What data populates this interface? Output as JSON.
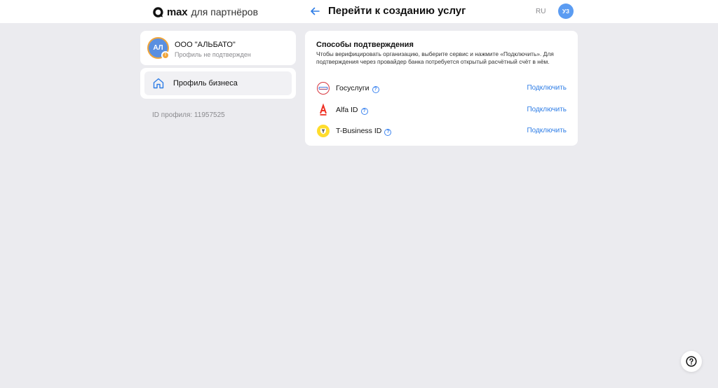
{
  "header": {
    "logo_brand": "max",
    "logo_suffix": "для партнёров",
    "title": "Перейти к созданию услуг",
    "lang": "RU",
    "user_initials": "УЗ"
  },
  "sidebar": {
    "org": {
      "initials": "АЛ",
      "badge": "!",
      "name": "ООО \"АЛЬБАТО\"",
      "status": "Профиль не подтвержден"
    },
    "nav": [
      {
        "label": "Профиль бизнеса",
        "icon": "home-icon"
      }
    ],
    "profile_id": "ID профиля: 11957525"
  },
  "confirmation": {
    "title": "Способы подтверждения",
    "description": "Чтобы верифицировать организацию, выберите сервис и нажмите «Подключить». Для подтверждения через провайдер банка потребуется открытый расчётный счёт в нём.",
    "providers": [
      {
        "name": "Госуслуги",
        "action": "Подключить",
        "icon": "gosuslugi-icon"
      },
      {
        "name": "Alfa ID",
        "action": "Подключить",
        "icon": "alfa-icon"
      },
      {
        "name": "T-Business ID",
        "action": "Подключить",
        "icon": "tbank-icon"
      }
    ]
  },
  "colors": {
    "background": "#ebebef",
    "accent": "#2e7de6",
    "avatar": "#5b9cf2",
    "warning": "#f0a53a",
    "alfa_red": "#ef3124",
    "tbank_yellow": "#ffdd2d"
  }
}
